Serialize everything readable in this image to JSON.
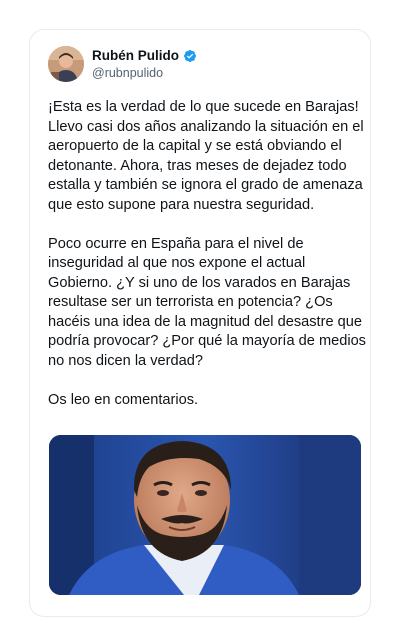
{
  "tweet": {
    "author": {
      "display_name": "Rubén Pulido",
      "handle": "@rubnpulido",
      "verified": true,
      "avatar_icon": "user-avatar"
    },
    "paragraphs": [
      "¡Esta es la verdad de lo que sucede en Barajas! Llevo casi dos años analizando la situación en el aeropuerto de la capital y se está obviando el detonante. Ahora, tras meses de dejadez todo estalla y también se ignora el grado de amenaza que esto supone para nuestra seguridad.",
      "Poco ocurre en España para el nivel de inseguridad al que nos expone el actual Gobierno. ¿Y si uno de los varados en Barajas resultase ser un terrorista en potencia? ¿Os hacéis una idea de la magnitud del desastre que podría provocar? ¿Por qué la mayoría de medios no nos dicen la verdad?",
      "Os leo en comentarios."
    ],
    "media": {
      "type": "video-still",
      "description_icon": "person-portrait-image"
    }
  },
  "colors": {
    "text": "#0f1419",
    "secondary_text": "#536471",
    "verified_badge": "#1d9bf0",
    "card_border": "#e9ecef"
  }
}
